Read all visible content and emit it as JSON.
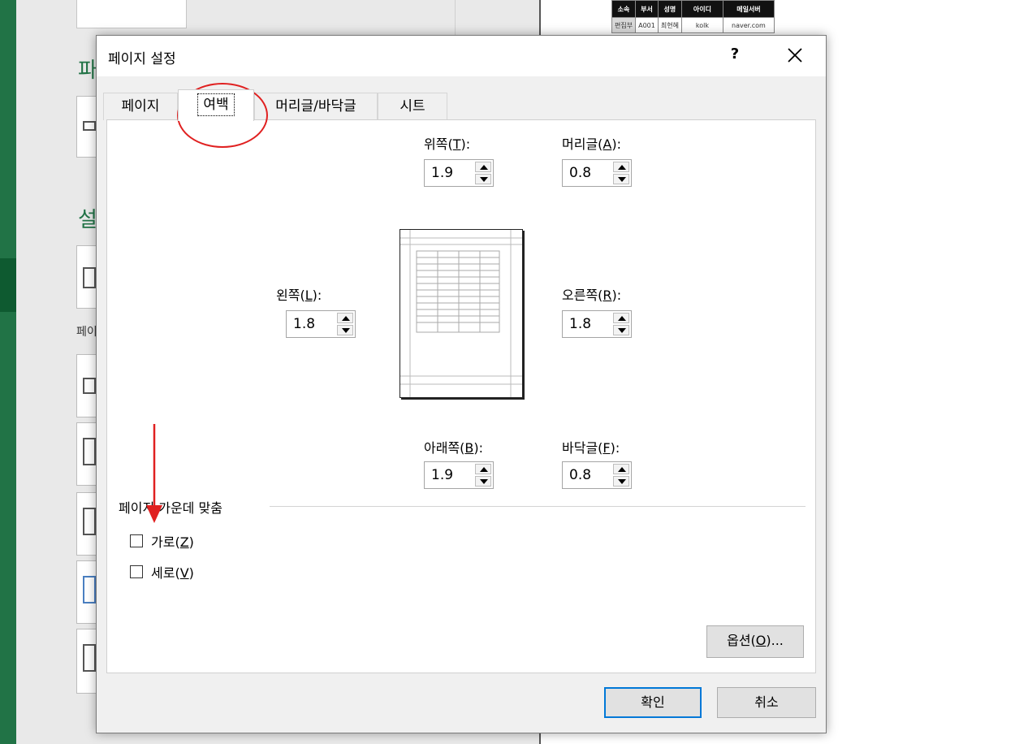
{
  "background": {
    "heading_1": "파",
    "heading_2": "설",
    "small_text": "페이",
    "sheet_headers": [
      "소속",
      "부서",
      "성명",
      "아이디",
      "메일서버"
    ],
    "sheet_row": [
      "편집부",
      "A001",
      "최현혜",
      "kolk",
      "naver.com"
    ]
  },
  "dialog": {
    "title": "페이지 설정",
    "help_label": "?",
    "tabs": [
      {
        "label": "페이지"
      },
      {
        "label": "여백"
      },
      {
        "label": "머리글/바닥글"
      },
      {
        "label": "시트"
      }
    ],
    "active_tab": "여백",
    "margins": {
      "top": {
        "label": "위쪽(",
        "key": "T",
        "suffix": "):",
        "value": "1.9"
      },
      "header": {
        "label": "머리글(",
        "key": "A",
        "suffix": "):",
        "value": "0.8"
      },
      "left": {
        "label": "왼쪽(",
        "key": "L",
        "suffix": "):",
        "value": "1.8"
      },
      "right": {
        "label": "오른쪽(",
        "key": "R",
        "suffix": "):",
        "value": "1.8"
      },
      "bottom": {
        "label": "아래쪽(",
        "key": "B",
        "suffix": "):",
        "value": "1.9"
      },
      "footer": {
        "label": "바닥글(",
        "key": "F",
        "suffix": "):",
        "value": "0.8"
      }
    },
    "center_section": {
      "title": "페이지 가운데 맞춤",
      "horizontal": {
        "label": "가로(",
        "key": "Z",
        "suffix": ")",
        "checked": false
      },
      "vertical": {
        "label": "세로(",
        "key": "V",
        "suffix": ")",
        "checked": false
      }
    },
    "options_button": {
      "label": "옵션(",
      "key": "O",
      "suffix": ")..."
    },
    "ok_button": "확인",
    "cancel_button": "취소"
  },
  "colors": {
    "excel_green": "#217346",
    "annotation_red": "#e02020",
    "focus_blue": "#0078d7"
  }
}
